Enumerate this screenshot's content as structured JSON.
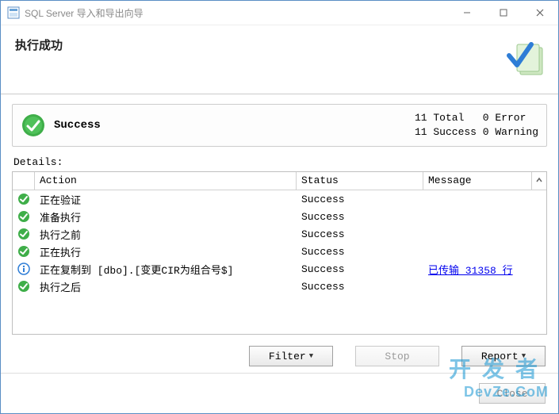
{
  "titlebar": {
    "title": "SQL Server 导入和导出向导"
  },
  "header": {
    "title": "执行成功"
  },
  "summary": {
    "result_label": "Success",
    "counts": {
      "total": 11,
      "success": 11,
      "error": 0,
      "warning": 0
    },
    "line1": "11 Total   0 Error",
    "line2": "11 Success 0 Warning"
  },
  "details": {
    "label": "Details:",
    "columns": {
      "action": "Action",
      "status": "Status",
      "message": "Message"
    },
    "rows": [
      {
        "icon": "success",
        "action": "正在验证",
        "status": "Success",
        "message": ""
      },
      {
        "icon": "success",
        "action": "准备执行",
        "status": "Success",
        "message": ""
      },
      {
        "icon": "success",
        "action": "执行之前",
        "status": "Success",
        "message": ""
      },
      {
        "icon": "success",
        "action": "正在执行",
        "status": "Success",
        "message": ""
      },
      {
        "icon": "info",
        "action": "正在复制到 [dbo].[变更CIR为组合号$]",
        "status": "Success",
        "message": "已传输 31358 行",
        "message_is_link": true
      },
      {
        "icon": "success",
        "action": "执行之后",
        "status": "Success",
        "message": ""
      }
    ]
  },
  "buttons": {
    "filter": "Filter",
    "stop": "Stop",
    "report": "Report",
    "close": "Close"
  },
  "watermark": {
    "cn": "开发者",
    "en": "DevZe.CoM"
  }
}
